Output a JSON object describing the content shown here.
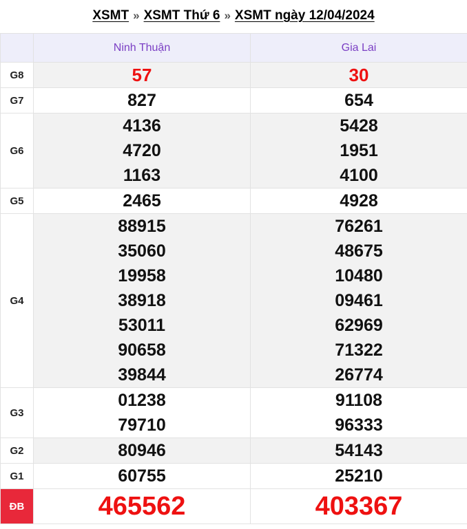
{
  "breadcrumb": {
    "items": [
      "XSMT",
      "XSMT Thứ 6",
      "XSMT ngày 12/04/2024"
    ],
    "separator": "»"
  },
  "table": {
    "provinces": [
      "Ninh Thuận",
      "Gia Lai"
    ],
    "prizes": {
      "g8": {
        "label": "G8",
        "values": [
          [
            "57"
          ],
          [
            "30"
          ]
        ]
      },
      "g7": {
        "label": "G7",
        "values": [
          [
            "827"
          ],
          [
            "654"
          ]
        ]
      },
      "g6": {
        "label": "G6",
        "values": [
          [
            "4136",
            "4720",
            "1163"
          ],
          [
            "5428",
            "1951",
            "4100"
          ]
        ]
      },
      "g5": {
        "label": "G5",
        "values": [
          [
            "2465"
          ],
          [
            "4928"
          ]
        ]
      },
      "g4": {
        "label": "G4",
        "values": [
          [
            "88915",
            "35060",
            "19958",
            "38918",
            "53011",
            "90658",
            "39844"
          ],
          [
            "76261",
            "48675",
            "10480",
            "09461",
            "62969",
            "71322",
            "26774"
          ]
        ]
      },
      "g3": {
        "label": "G3",
        "values": [
          [
            "01238",
            "79710"
          ],
          [
            "91108",
            "96333"
          ]
        ]
      },
      "g2": {
        "label": "G2",
        "values": [
          [
            "80946"
          ],
          [
            "54143"
          ]
        ]
      },
      "g1": {
        "label": "G1",
        "values": [
          [
            "60755"
          ],
          [
            "25210"
          ]
        ]
      },
      "db": {
        "label": "ĐB",
        "values": [
          [
            "465562"
          ],
          [
            "403367"
          ]
        ]
      }
    }
  },
  "colors": {
    "header_bg": "#eeeefa",
    "header_text": "#7b3fc4",
    "accent_red": "#e11111",
    "db_label_bg": "#e8283a",
    "shade_row": "#f2f2f2"
  }
}
